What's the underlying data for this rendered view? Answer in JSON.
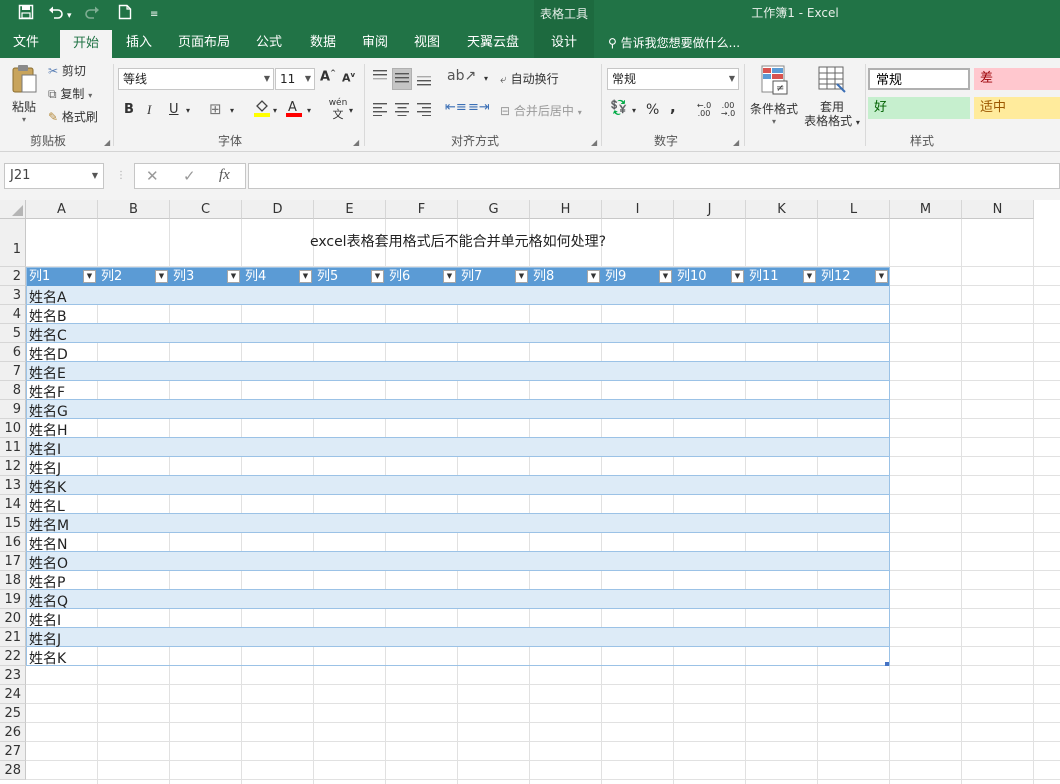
{
  "app": {
    "context_tab_group": "表格工具",
    "window_title": "工作簿1 - Excel",
    "quick_access": {
      "save_icon": "save-icon",
      "undo_icon": "undo-icon",
      "redo_icon": "redo-icon",
      "new_icon": "new-doc-icon",
      "customize_icon": "customize-qa-icon"
    }
  },
  "tabs": [
    {
      "label": "文件"
    },
    {
      "label": "开始",
      "active": true
    },
    {
      "label": "插入"
    },
    {
      "label": "页面布局"
    },
    {
      "label": "公式"
    },
    {
      "label": "数据"
    },
    {
      "label": "审阅"
    },
    {
      "label": "视图"
    },
    {
      "label": "天翼云盘"
    },
    {
      "label": "设计",
      "contextual": true
    }
  ],
  "tell_me": "告诉我您想要做什么...",
  "ribbon": {
    "clipboard": {
      "paste": "粘贴",
      "cut": "剪切",
      "copy": "复制",
      "format_painter": "格式刷",
      "label": "剪贴板"
    },
    "font": {
      "name": "等线",
      "size": "11",
      "bold": "B",
      "italic": "I",
      "underline": "U",
      "grow": "A",
      "shrink": "A",
      "wen": "wén",
      "wen_sub": "文",
      "label": "字体"
    },
    "alignment": {
      "wrap": "自动换行",
      "merge": "合并后居中",
      "label": "对齐方式"
    },
    "number": {
      "format": "常规",
      "percent": "%",
      "comma": ",",
      "inc_dec": "←.0 .00",
      "dec_dec": ".00 →.0",
      "label": "数字"
    },
    "styles_buttons": {
      "conditional": "条件格式",
      "table_line1": "套用",
      "table_line2": "表格格式",
      "label": "样式"
    },
    "styles": [
      {
        "label": "常规",
        "bg": "#ffffff",
        "fg": "#000000"
      },
      {
        "label": "差",
        "bg": "#ffc7ce",
        "fg": "#9c0006"
      },
      {
        "label": "好",
        "bg": "#c6efce",
        "fg": "#006100"
      },
      {
        "label": "适中",
        "bg": "#ffeb9c",
        "fg": "#9c5700"
      }
    ]
  },
  "formula_bar": {
    "name_box": "J21",
    "cancel": "✕",
    "enter": "✓",
    "fx": "fx",
    "value": ""
  },
  "sheet": {
    "columns": [
      "A",
      "B",
      "C",
      "D",
      "E",
      "F",
      "G",
      "H",
      "I",
      "J",
      "K",
      "L",
      "M",
      "N"
    ],
    "rows": [
      "1",
      "2",
      "3",
      "4",
      "5",
      "6",
      "7",
      "8",
      "9",
      "10",
      "11",
      "12",
      "13",
      "14",
      "15",
      "16",
      "17",
      "18",
      "19",
      "20",
      "21",
      "22",
      "23",
      "24",
      "25",
      "26",
      "27",
      "28"
    ],
    "title": "excel表格套用格式后不能合并单元格如何处理?",
    "table_headers": [
      "列1",
      "列2",
      "列3",
      "列4",
      "列5",
      "列6",
      "列7",
      "列8",
      "列9",
      "列10",
      "列11",
      "列12"
    ],
    "names": [
      "姓名A",
      "姓名B",
      "姓名C",
      "姓名D",
      "姓名E",
      "姓名F",
      "姓名G",
      "姓名H",
      "姓名I",
      "姓名J",
      "姓名K",
      "姓名L",
      "姓名M",
      "姓名N",
      "姓名O",
      "姓名P",
      "姓名Q",
      "姓名I",
      "姓名J",
      "姓名K"
    ],
    "colors": {
      "header": "#5b9bd5",
      "band": "#ddebf7",
      "line": "#9bc2e6"
    }
  }
}
